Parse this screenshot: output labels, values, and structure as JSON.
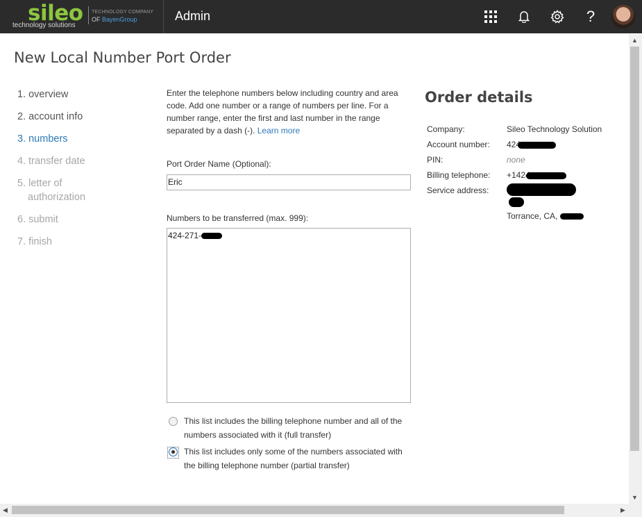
{
  "header": {
    "logo_word": "sileo",
    "logo_sub": "technology solutions",
    "logo_tag_line1": "TECHNOLOGY COMPANY",
    "logo_tag_of": "OF ",
    "logo_tag_brand": "BayenGroup",
    "app_title": "Admin",
    "icons": [
      "app-launcher-icon",
      "bell-icon",
      "gear-icon",
      "help-icon",
      "avatar"
    ],
    "help_glyph": "?"
  },
  "page_title": "New Local Number Port Order",
  "steps": [
    {
      "label": "1. overview",
      "state": "done"
    },
    {
      "label": "2. account info",
      "state": "done"
    },
    {
      "label": "3. numbers",
      "state": "active"
    },
    {
      "label": "4. transfer date",
      "state": "pending"
    },
    {
      "label_line1": "5. letter of",
      "label_line2": "authorization",
      "state": "pending"
    },
    {
      "label": "6. submit",
      "state": "pending"
    },
    {
      "label": "7. finish",
      "state": "pending"
    }
  ],
  "instructions": {
    "text": "Enter the telephone numbers below including country and area code. Add one number or a range of numbers per line. For a number range, enter the first and last number in the range separated by a dash (-).",
    "learn_more": "Learn more"
  },
  "form": {
    "port_order_name_label": "Port Order Name (Optional):",
    "port_order_name_value": "Eric",
    "numbers_label": "Numbers to be transferred (max. 999):",
    "numbers_value": "424-271-",
    "radio_full_line1": "This list includes the billing telephone number and all of the",
    "radio_full_line2": "numbers associated with it (full transfer)",
    "radio_partial_line1": "This list includes only some of the numbers associated with",
    "radio_partial_line2": "the billing telephone number (partial transfer)",
    "selected_option": "partial"
  },
  "order_details": {
    "title": "Order details",
    "company_label": "Company:",
    "company_value": "Sileo Technology Solution",
    "account_label": "Account number:",
    "account_value": "424",
    "pin_label": "PIN:",
    "pin_value": "none",
    "billing_label": "Billing telephone:",
    "billing_value": "+1424",
    "service_label": "Service address:",
    "service_city": "Torrance, CA, "
  },
  "colors": {
    "topbar": "#2b2b2b",
    "logo_green": "#8cc63f",
    "accent_blue": "#2d78b8",
    "muted_step": "#a6a6a6"
  }
}
